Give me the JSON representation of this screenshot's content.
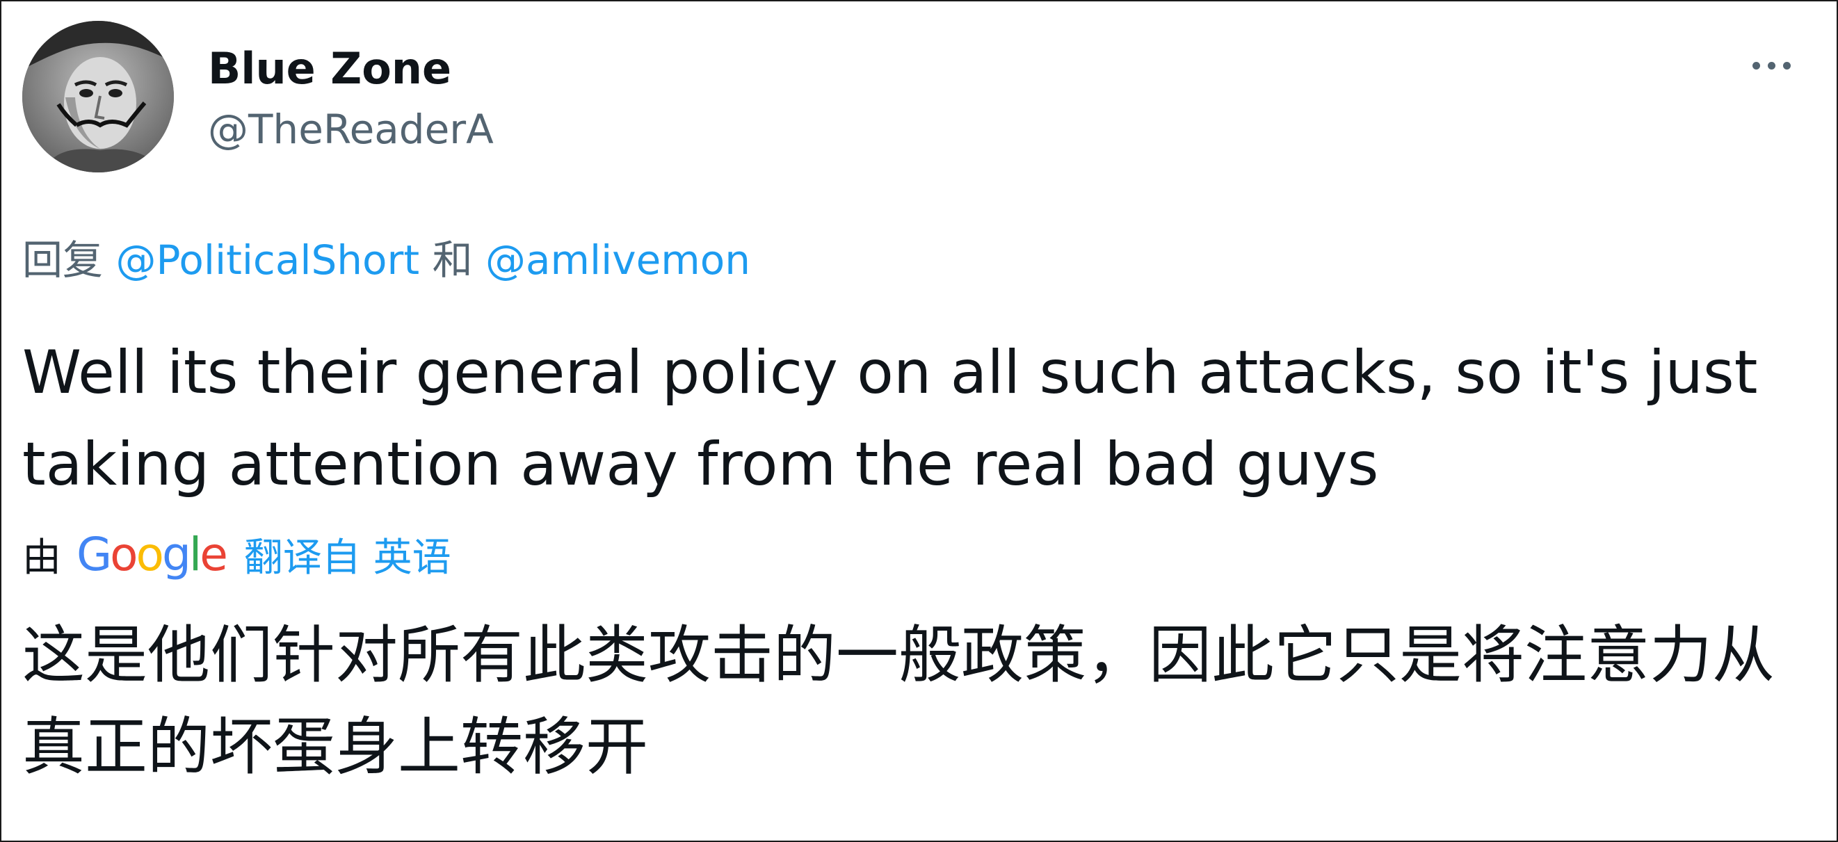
{
  "user": {
    "display_name": "Blue Zone",
    "handle": "@TheReaderA"
  },
  "reply": {
    "prefix": "回复",
    "mention_1": "@PoliticalShort",
    "conjunction": "和",
    "mention_2": "@amlivemon"
  },
  "tweet": {
    "text": "Well its their general policy on all such attacks, so it's just taking attention away from the real bad guys"
  },
  "translation": {
    "by": "由",
    "provider_letters": [
      "G",
      "o",
      "o",
      "g",
      "l",
      "e"
    ],
    "provider_colors": [
      "#4285f4",
      "#ea4335",
      "#fbbc05",
      "#4285f4",
      "#34a853",
      "#ea4335"
    ],
    "translated_from": "翻译自 英语",
    "text": "这是他们针对所有此类攻击的一般政策，因此它只是将注意力从真正的坏蛋身上转移开"
  },
  "icons": {
    "more": "more-horizontal-icon"
  },
  "colors": {
    "text_primary": "#0f1419",
    "text_secondary": "#536471",
    "link": "#1d9bf0"
  }
}
